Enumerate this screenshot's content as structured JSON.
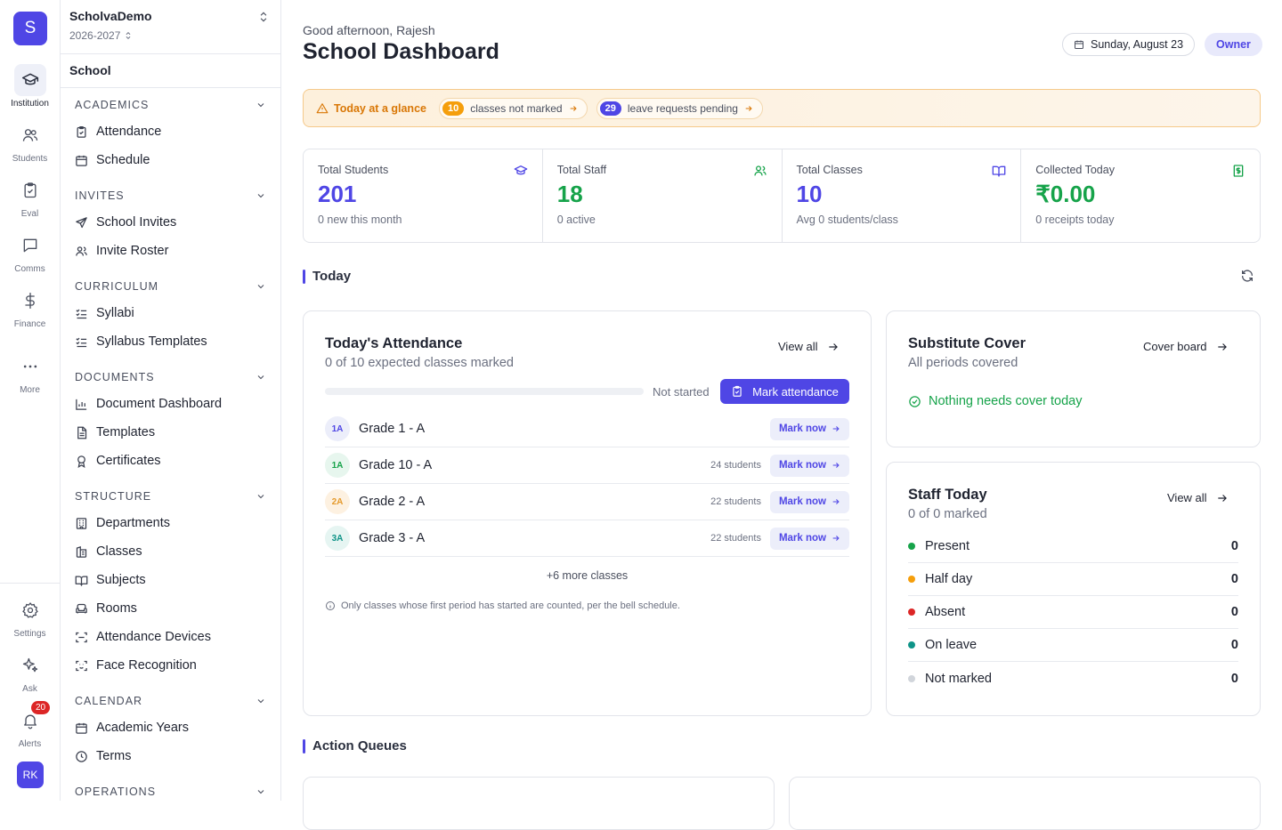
{
  "rail": {
    "logo": "S",
    "items": [
      {
        "label": "Institution",
        "icon": "graduation-cap-icon"
      },
      {
        "label": "Students",
        "icon": "users-icon"
      },
      {
        "label": "Eval",
        "icon": "clipboard-check-icon"
      },
      {
        "label": "Comms",
        "icon": "message-square-icon"
      },
      {
        "label": "Finance",
        "icon": "dollar-icon"
      },
      {
        "label": "More",
        "icon": "more-dots-icon"
      }
    ],
    "bottom": [
      {
        "label": "Settings",
        "icon": "gear-icon"
      },
      {
        "label": "Ask",
        "icon": "sparkles-icon"
      },
      {
        "label": "Alerts",
        "icon": "bell-icon",
        "badge": "20"
      }
    ],
    "avatar": "RK"
  },
  "sidebar": {
    "org": "ScholvaDemo",
    "year": "2026-2027",
    "section_title": "School",
    "groups": [
      {
        "title": "ACADEMICS",
        "items": [
          "Attendance",
          "Schedule"
        ]
      },
      {
        "title": "INVITES",
        "items": [
          "School Invites",
          "Invite Roster"
        ]
      },
      {
        "title": "CURRICULUM",
        "items": [
          "Syllabi",
          "Syllabus Templates"
        ]
      },
      {
        "title": "DOCUMENTS",
        "items": [
          "Document Dashboard",
          "Templates",
          "Certificates"
        ]
      },
      {
        "title": "STRUCTURE",
        "items": [
          "Departments",
          "Classes",
          "Subjects",
          "Rooms",
          "Attendance Devices",
          "Face Recognition"
        ]
      },
      {
        "title": "CALENDAR",
        "items": [
          "Academic Years",
          "Terms"
        ]
      },
      {
        "title": "OPERATIONS",
        "items": []
      }
    ]
  },
  "header": {
    "greeting": "Good afternoon, Rajesh",
    "title": "School Dashboard",
    "date": "Sunday, August 23",
    "role": "Owner"
  },
  "glance": {
    "title": "Today at a glance",
    "chips": [
      {
        "count": "10",
        "label": "classes not marked",
        "color": "#f59e0b"
      },
      {
        "count": "29",
        "label": "leave requests pending",
        "color": "#4f46e5"
      }
    ]
  },
  "stats": [
    {
      "label": "Total Students",
      "value": "201",
      "sub": "0 new this month",
      "color": "#4f46e5",
      "icon": "graduation-cap-icon"
    },
    {
      "label": "Total Staff",
      "value": "18",
      "sub": "0 active",
      "color": "#16a34a",
      "icon": "users-icon"
    },
    {
      "label": "Total Classes",
      "value": "10",
      "sub": "Avg 0 students/class",
      "color": "#4f46e5",
      "icon": "book-open-icon"
    },
    {
      "label": "Collected Today",
      "value": "₹0.00",
      "sub": "0 receipts today",
      "color": "#16a34a",
      "icon": "banknote-icon"
    }
  ],
  "today": {
    "heading": "Today",
    "attendance": {
      "title": "Today's Attendance",
      "subtitle": "0 of 10 expected classes marked",
      "view_all": "View all",
      "progress": 0,
      "status": "Not started",
      "mark_button": "Mark attendance",
      "rows": [
        {
          "badge": "1A",
          "name": "Grade 1 - A",
          "count": "",
          "action": "Mark now",
          "bg": "#eceefa",
          "fg": "#4f46e5"
        },
        {
          "badge": "1A",
          "name": "Grade 10 - A",
          "count": "24 students",
          "action": "Mark now",
          "bg": "#e7f6ee",
          "fg": "#16a34a"
        },
        {
          "badge": "2A",
          "name": "Grade 2 - A",
          "count": "22 students",
          "action": "Mark now",
          "bg": "#fdf1e1",
          "fg": "#e59a2c"
        },
        {
          "badge": "3A",
          "name": "Grade 3 - A",
          "count": "22 students",
          "action": "Mark now",
          "bg": "#e6f5f2",
          "fg": "#0f9488"
        }
      ],
      "more": "+6 more classes",
      "note": "Only classes whose first period has started are counted, per the bell schedule."
    },
    "substitute": {
      "title": "Substitute Cover",
      "subtitle": "All periods covered",
      "link": "Cover board",
      "status": "Nothing needs cover today"
    },
    "staff": {
      "title": "Staff Today",
      "subtitle": "0 of 0 marked",
      "view_all": "View all",
      "rows": [
        {
          "label": "Present",
          "value": "0",
          "color": "#16a34a"
        },
        {
          "label": "Half day",
          "value": "0",
          "color": "#f59e0b"
        },
        {
          "label": "Absent",
          "value": "0",
          "color": "#dc2626"
        },
        {
          "label": "On leave",
          "value": "0",
          "color": "#0f9488"
        },
        {
          "label": "Not marked",
          "value": "0",
          "color": "#d1d5db"
        }
      ]
    }
  },
  "queues": {
    "heading": "Action Queues"
  }
}
